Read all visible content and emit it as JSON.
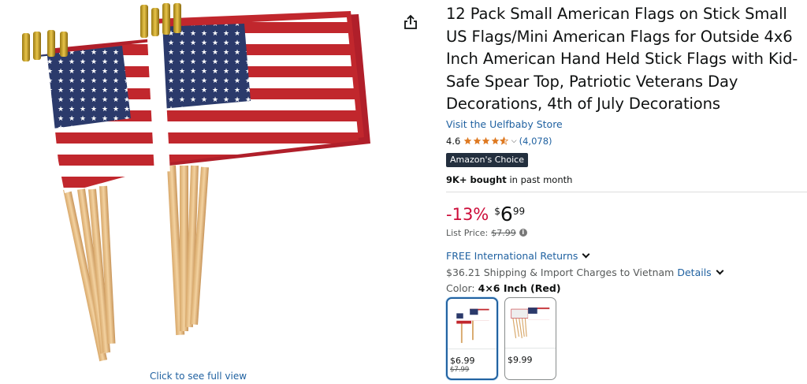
{
  "gallery": {
    "full_view_text": "Click to see full view"
  },
  "share": {
    "icon": "share-icon"
  },
  "product": {
    "title": "12 Pack Small American Flags on Stick Small US Flags/Mini American Flags for Outside 4x6 Inch American Hand Held Stick Flags with Kid-Safe Spear Top, Patriotic Veterans Day Decorations, 4th of July Decorations",
    "store_link": "Visit the Uelfbaby Store",
    "rating": "4.6",
    "rating_value": 4.6,
    "review_count": "(4,078)",
    "badge": "Amazon's Choice",
    "bought_bold": "9K+ bought",
    "bought_rest": " in past month",
    "discount": "-13%",
    "price_symbol": "$",
    "price_whole": "6",
    "price_fraction": "99",
    "list_price_label": "List Price:",
    "list_price_value": "$7.99",
    "returns_text": "FREE International Returns",
    "shipping_text": "$36.21 Shipping & Import Charges to Vietnam",
    "shipping_details": "Details",
    "color_label": "Color:",
    "color_value": "4×6 Inch (Red)"
  },
  "swatches": [
    {
      "price": "$6.99",
      "old_price": "$7.99",
      "selected": true
    },
    {
      "price": "$9.99",
      "old_price": "",
      "selected": false
    }
  ],
  "colors": {
    "link": "#2162a1",
    "discount": "#cc0c39",
    "star": "#de7921",
    "badge_bg": "#232f3e",
    "flag_red": "#b22234",
    "flag_blue": "#3c3b6e"
  }
}
